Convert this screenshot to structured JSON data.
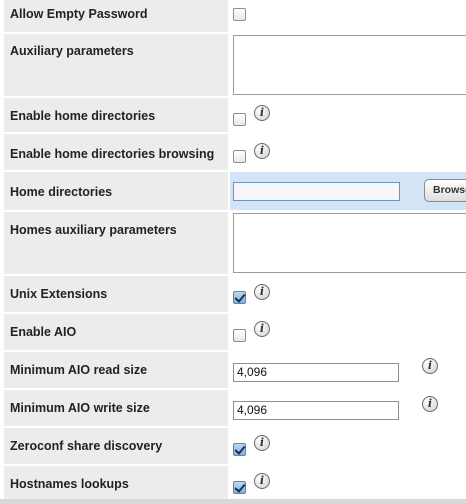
{
  "rows": [
    {
      "label": "Allow Empty Password",
      "type": "checkbox",
      "checked": false,
      "info": false
    },
    {
      "label": "Auxiliary parameters",
      "type": "textarea",
      "value": ""
    },
    {
      "label": "Enable home directories",
      "type": "checkbox",
      "checked": false,
      "info": true
    },
    {
      "label": "Enable home directories browsing",
      "type": "checkbox",
      "checked": false,
      "info": true
    },
    {
      "label": "Home directories",
      "type": "path",
      "value": "",
      "button_label": "Browse"
    },
    {
      "label": "Homes auxiliary parameters",
      "type": "textarea",
      "value": ""
    },
    {
      "label": "Unix Extensions",
      "type": "checkbox",
      "checked": true,
      "info": true
    },
    {
      "label": "Enable AIO",
      "type": "checkbox",
      "checked": false,
      "info": true
    },
    {
      "label": "Minimum AIO read size",
      "type": "text",
      "value": "4,096",
      "info": true
    },
    {
      "label": "Minimum AIO write size",
      "type": "text",
      "value": "4,096",
      "info": true
    },
    {
      "label": "Zeroconf share discovery",
      "type": "checkbox",
      "checked": true,
      "info": true
    },
    {
      "label": "Hostnames lookups",
      "type": "checkbox",
      "checked": true,
      "info": true
    }
  ],
  "icons": {
    "info": "info-icon",
    "checkbox_check": "checkmark-icon"
  },
  "colors": {
    "label_bg": "#ececec",
    "highlight_bg": "#d3e4f6",
    "checked_bg": "#7fb0e4"
  },
  "info_glyph": "i"
}
